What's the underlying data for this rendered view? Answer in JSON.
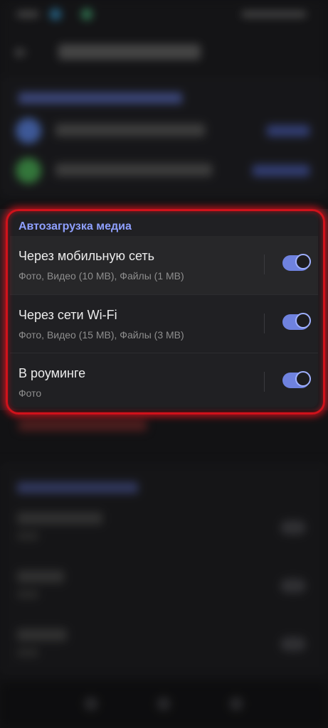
{
  "colors": {
    "accent": "#8fa0ff",
    "toggle_on": "#6f82df",
    "highlight": "#d0121b",
    "background": "#1c1c1f"
  },
  "media_autoload": {
    "header": "Автозагрузка медиа",
    "rows": [
      {
        "label": "Через мобильную сеть",
        "sub": "Фото, Видео (10 MB), Файлы (1 MB)",
        "enabled": true
      },
      {
        "label": "Через сети Wi-Fi",
        "sub": "Фото, Видео (15 MB), Файлы (3 MB)",
        "enabled": true
      },
      {
        "label": "В роуминге",
        "sub": "Фото",
        "enabled": true
      }
    ]
  },
  "icons": [
    "back-arrow-icon",
    "nav-back-icon",
    "nav-home-icon",
    "nav-recents-icon"
  ]
}
